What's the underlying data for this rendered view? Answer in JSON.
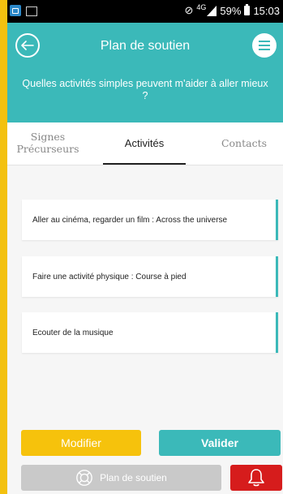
{
  "status_bar": {
    "network": "4G",
    "battery_percent": "59%",
    "time": "15:03"
  },
  "header": {
    "title": "Plan de soutien",
    "subtitle": "Quelles activités simples peuvent m'aider à aller mieux ?"
  },
  "tabs": [
    {
      "label": "Signes Précurseurs",
      "active": false
    },
    {
      "label": "Activités",
      "active": true
    },
    {
      "label": "Contacts",
      "active": false
    }
  ],
  "activities": [
    "Aller au cinéma, regarder un film : Across the universe",
    "Faire une activité physique : Course à pied",
    "Ecouter de la musique"
  ],
  "actions": {
    "modifier": "Modifier",
    "valider": "Valider"
  },
  "bottom_nav": {
    "plan_label": "Plan de soutien",
    "plan_icon": "lifebuoy-icon",
    "alert_icon": "bell-icon"
  },
  "colors": {
    "primary": "#3bb9b9",
    "accent": "#f6c20c",
    "alert": "#d61c1c",
    "disabled": "#c9c9c9"
  }
}
